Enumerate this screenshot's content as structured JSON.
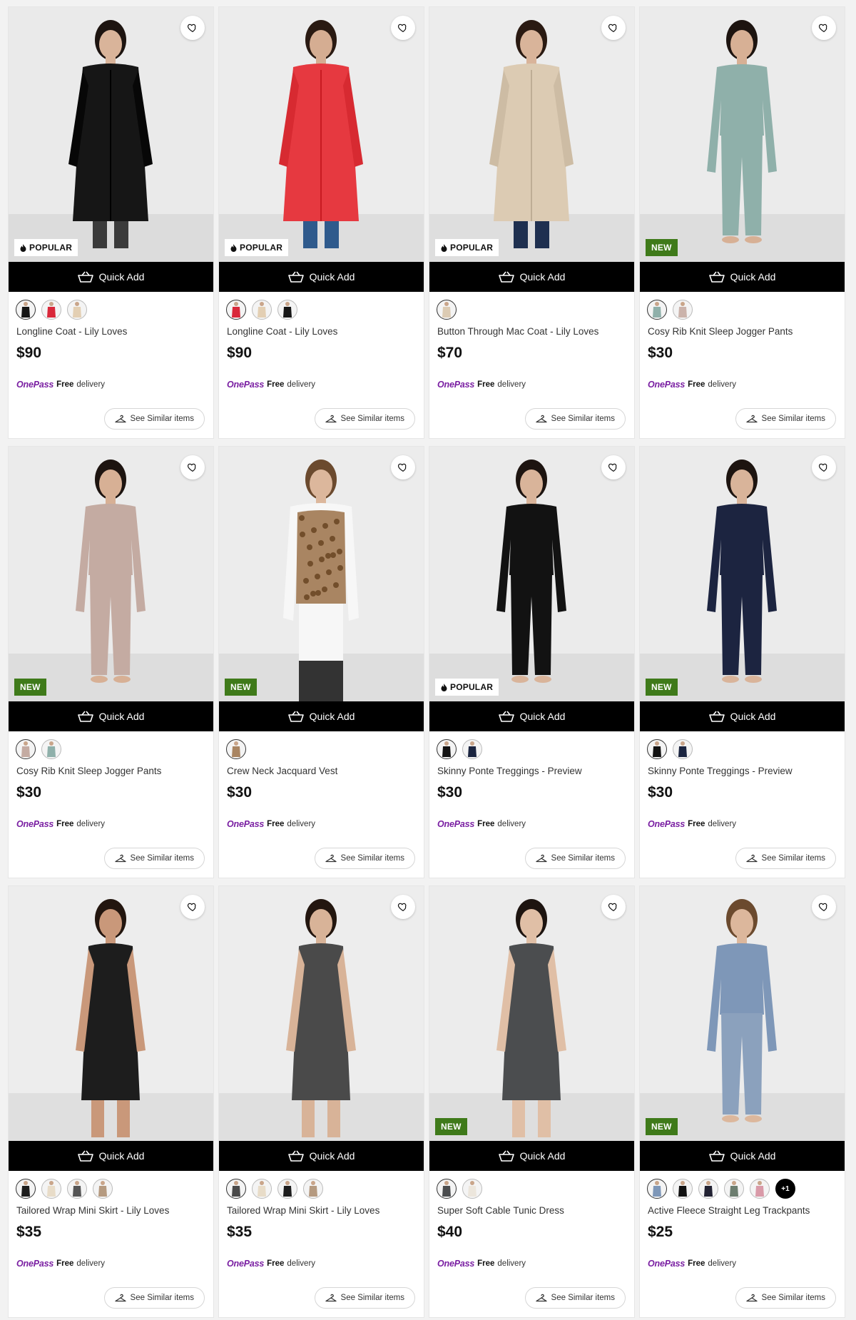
{
  "common": {
    "quick_add_label": "Quick Add",
    "onepass_logo": "OnePass",
    "onepass_free": "Free",
    "onepass_delivery": "delivery",
    "see_similar_label": "See Similar items",
    "badge_popular": "POPULAR",
    "badge_new": "NEW"
  },
  "colors": {
    "brand_onepass": "#7a1fa2",
    "badge_new_bg": "#3f7a1a",
    "quick_add_bg": "#000000"
  },
  "products": [
    {
      "title": "Longline Coat - Lily Loves",
      "price": "$90",
      "badge": "popular",
      "garment": "#161616",
      "pants": "#3b3b3b",
      "skin": "#d9b49a",
      "hair": "#1d1410",
      "bg": "#eaeaea",
      "swatches": [
        "#161616",
        "#d9283a",
        "#e3cfb3"
      ]
    },
    {
      "title": "Longline Coat - Lily Loves",
      "price": "$90",
      "badge": "popular",
      "garment": "#e63940",
      "pants": "#2f5a8c",
      "skin": "#d5ad92",
      "hair": "#2a1a12",
      "bg": "#ececec",
      "swatches": [
        "#d9283a",
        "#e3cfb3",
        "#161616"
      ]
    },
    {
      "title": "Button Through Mac Coat - Lily Loves",
      "price": "$70",
      "badge": "popular",
      "garment": "#dccbb3",
      "pants": "#1f3050",
      "skin": "#d9b49a",
      "hair": "#2a1a12",
      "bg": "#ececec",
      "swatches": [
        "#dccbb3"
      ]
    },
    {
      "title": "Cosy Rib Knit Sleep Jogger Pants",
      "price": "$30",
      "badge": "new",
      "garment": "#8fb0aa",
      "pants": "#8fb0aa",
      "skin": "#d7b095",
      "hair": "#1d1410",
      "bg": "#ebebeb",
      "swatches": [
        "#8fb0aa",
        "#cbb3ab"
      ]
    },
    {
      "title": "Cosy Rib Knit Sleep Jogger Pants",
      "price": "$30",
      "badge": "new",
      "garment": "#c4aba2",
      "pants": "#c4aba2",
      "skin": "#d7b095",
      "hair": "#1d1410",
      "bg": "#ebebeb",
      "swatches": [
        "#c4aba2",
        "#8fb0aa"
      ]
    },
    {
      "title": "Crew Neck Jacquard Vest",
      "price": "$30",
      "badge": "new",
      "garment": "#a98562",
      "pants": "#333333",
      "skin": "#dcb79c",
      "hair": "#6b4a2e",
      "bg": "#ececec",
      "swatches": [
        "#a98562"
      ]
    },
    {
      "title": "Skinny Ponte Treggings - Preview",
      "price": "$30",
      "badge": "popular",
      "garment": "#121212",
      "pants": "#121212",
      "skin": "#d9b49a",
      "hair": "#1d1410",
      "bg": "#ebebeb",
      "swatches": [
        "#121212",
        "#1b2540"
      ]
    },
    {
      "title": "Skinny Ponte Treggings - Preview",
      "price": "$30",
      "badge": "new",
      "garment": "#1c2440",
      "pants": "#1c2440",
      "skin": "#d9b49a",
      "hair": "#1d1410",
      "bg": "#ebebeb",
      "swatches": [
        "#121212",
        "#1b2540"
      ]
    },
    {
      "title": "Tailored Wrap Mini Skirt - Lily Loves",
      "price": "$35",
      "badge": "",
      "garment": "#1d1d1d",
      "pants": "#1d1d1d",
      "skin": "#c9987a",
      "hair": "#23160f",
      "bg": "#ededed",
      "swatches": [
        "#1d1d1d",
        "#e8dcc8",
        "#555555",
        "#b59a80"
      ]
    },
    {
      "title": "Tailored Wrap Mini Skirt - Lily Loves",
      "price": "$35",
      "badge": "",
      "garment": "#4a4a4a",
      "pants": "#4a4a4a",
      "skin": "#d8b398",
      "hair": "#23160f",
      "bg": "#ededed",
      "swatches": [
        "#4a4a4a",
        "#e8dcc8",
        "#1d1d1d",
        "#b59a80"
      ]
    },
    {
      "title": "Super Soft Cable Tunic Dress",
      "price": "$40",
      "badge": "new",
      "garment": "#4b4d4f",
      "pants": "#4b4d4f",
      "skin": "#e0bfa6",
      "hair": "#1d1410",
      "bg": "#ececec",
      "swatches": [
        "#4b4d4f",
        "#ece6dc"
      ]
    },
    {
      "title": "Active Fleece Straight Leg Trackpants",
      "price": "$25",
      "badge": "new",
      "garment": "#7e97b8",
      "pants": "#8ba1bd",
      "skin": "#dcb79c",
      "hair": "#6b4a2e",
      "bg": "#ececec",
      "swatches": [
        "#7e97b8",
        "#111111",
        "#222233",
        "#6c7d6f",
        "#d99aa8"
      ],
      "more": "+1"
    }
  ]
}
